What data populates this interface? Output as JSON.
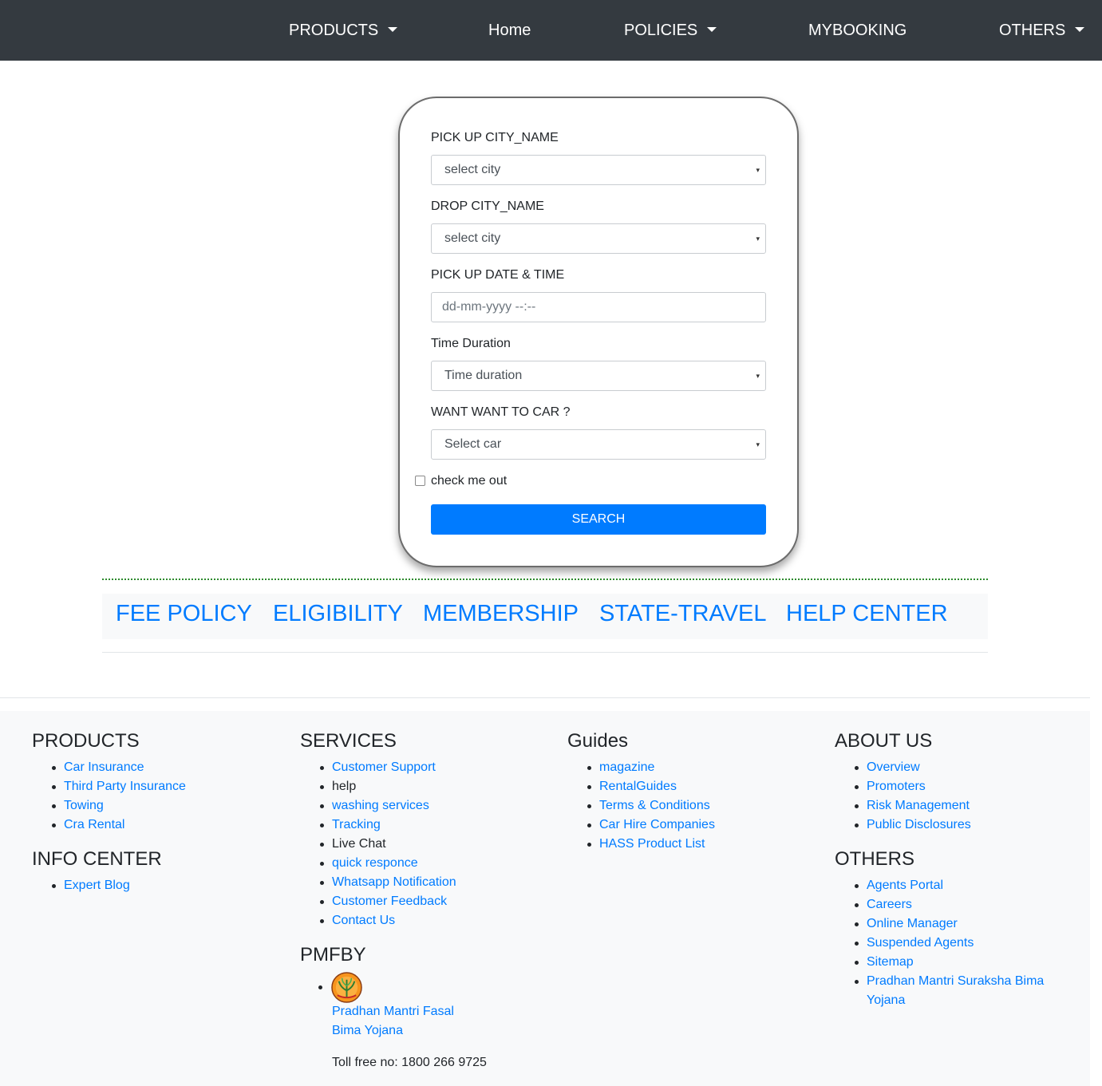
{
  "navbar": {
    "items": [
      {
        "label": "PRODUCTS",
        "dropdown": true
      },
      {
        "label": "Home",
        "dropdown": false
      },
      {
        "label": "POLICIES",
        "dropdown": true
      },
      {
        "label": "MYBOOKING",
        "dropdown": false
      },
      {
        "label": "OTHERS",
        "dropdown": true
      }
    ]
  },
  "form": {
    "pickup_city_label": "PICK UP CITY_NAME",
    "pickup_city_value": "select city",
    "drop_city_label": "DROP CITY_NAME",
    "drop_city_value": "select city",
    "pickup_datetime_label": "PICK UP DATE & TIME",
    "pickup_datetime_placeholder": "dd-mm-yyyy --:--",
    "duration_label": "Time Duration",
    "duration_value": "Time duration",
    "car_label": "WANT WANT TO CAR ?",
    "car_value": "Select car",
    "checkbox_label": "check me out",
    "search_label": "SEARCH",
    "select_arrow": "▾"
  },
  "subnav": {
    "links": [
      "FEE POLICY",
      "ELIGIBILITY",
      "MEMBERSHIP",
      "STATE-TRAVEL",
      "HELP CENTER"
    ]
  },
  "footer": {
    "products": {
      "heading": "PRODUCTS",
      "items": [
        "Car Insurance",
        "Third Party Insurance",
        "Towing",
        "Cra Rental"
      ]
    },
    "info_center": {
      "heading": "INFO CENTER",
      "items": [
        "Expert Blog"
      ]
    },
    "services": {
      "heading": "SERVICES",
      "items": [
        {
          "label": "Customer Support",
          "link": true
        },
        {
          "label": "help",
          "link": false
        },
        {
          "label": "washing services",
          "link": true
        },
        {
          "label": "Tracking",
          "link": true
        },
        {
          "label": "Live Chat",
          "link": false
        },
        {
          "label": "quick responce",
          "link": true
        },
        {
          "label": "Whatsapp Notification",
          "link": true
        },
        {
          "label": "Customer Feedback",
          "link": true
        },
        {
          "label": "Contact Us",
          "link": true
        }
      ]
    },
    "pmfby": {
      "heading": "PMFBY",
      "link_label": "Pradhan Mantri Fasal Bima Yojana",
      "tollfree": "Toll free no: 1800 266 9725"
    },
    "guides": {
      "heading": "Guides",
      "items": [
        "magazine",
        "RentalGuides",
        "Terms & Conditions",
        "Car Hire Companies",
        "HASS Product List"
      ]
    },
    "about_us": {
      "heading": "ABOUT US",
      "items": [
        "Overview",
        "Promoters",
        "Risk Management",
        "Public Disclosures"
      ]
    },
    "others": {
      "heading": "OTHERS",
      "items": [
        "Agents Portal",
        "Careers",
        "Online Manager",
        "Suspended Agents",
        "Sitemap",
        "Pradhan Mantri Suraksha Bima Yojana"
      ]
    }
  }
}
